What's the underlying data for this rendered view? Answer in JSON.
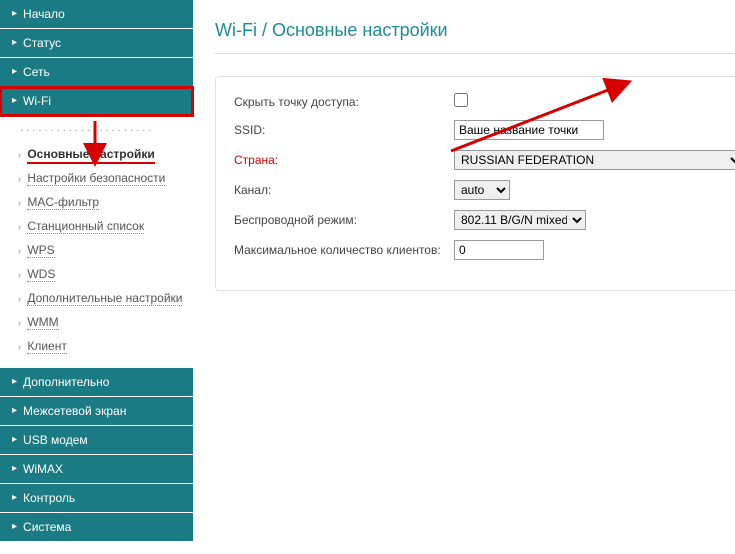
{
  "nav": {
    "items": [
      {
        "label": "Начало"
      },
      {
        "label": "Статус"
      },
      {
        "label": "Сеть"
      },
      {
        "label": "Wi-Fi"
      },
      {
        "label": "Дополнительно"
      },
      {
        "label": "Межсетевой экран"
      },
      {
        "label": "USB модем"
      },
      {
        "label": "WiMAX"
      },
      {
        "label": "Контроль"
      },
      {
        "label": "Система"
      }
    ]
  },
  "subnav": {
    "items": [
      {
        "label": "Основные настройки"
      },
      {
        "label": "Настройки безопасности"
      },
      {
        "label": "MAC-фильтр"
      },
      {
        "label": "Станционный список"
      },
      {
        "label": "WPS"
      },
      {
        "label": "WDS"
      },
      {
        "label": "Дополнительные настройки"
      },
      {
        "label": "WMM"
      },
      {
        "label": "Клиент"
      }
    ]
  },
  "page": {
    "title": "Wi-Fi / Основные настройки"
  },
  "form": {
    "hide_ap_label": "Скрыть точку доступа:",
    "hide_ap_checked": false,
    "ssid_label": "SSID:",
    "ssid_value": "Ваше название точки",
    "country_label": "Страна:",
    "country_value": "RUSSIAN FEDERATION",
    "channel_label": "Канал:",
    "channel_value": "auto",
    "mode_label": "Беспроводной режим:",
    "mode_value": "802.11 B/G/N mixed",
    "max_clients_label": "Максимальное количество клиентов:",
    "max_clients_value": "0"
  }
}
